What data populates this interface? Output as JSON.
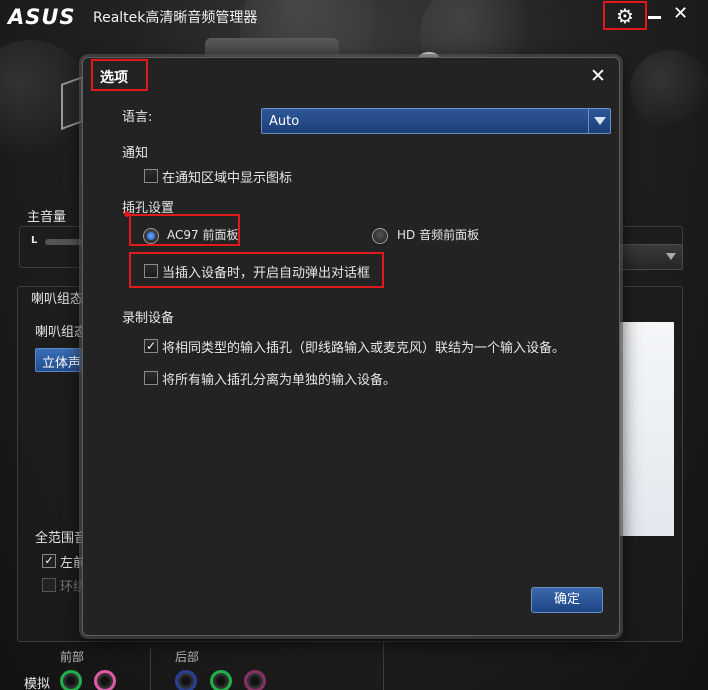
{
  "app": {
    "brand": "ASUS",
    "title": "Realtek高清晰音频管理器"
  },
  "background": {
    "main_volume_label": "主音量",
    "channel_label_L": "L",
    "speaker_config_tab": "喇叭组态",
    "speaker_config_label": "喇叭组态",
    "stereo_button": "立体声",
    "full_range_label": "全范围音",
    "front_lr_label": "左前",
    "surround_label": "环绕",
    "front_label": "前部",
    "rear_label": "后部",
    "analog_label": "模拟"
  },
  "dialog": {
    "title": "选项",
    "language": {
      "label": "语言:",
      "value": "Auto"
    },
    "notification": {
      "heading": "通知",
      "show_icon_label": "在通知区域中显示图标",
      "show_icon_checked": false
    },
    "jack_settings": {
      "heading": "插孔设置",
      "ac97_label": "AC97 前面板",
      "hd_label": "HD 音频前面板",
      "selected": "AC97 前面板",
      "popup_label": "当插入设备时，开启自动弹出对话框",
      "popup_checked": false
    },
    "recording": {
      "heading": "录制设备",
      "combine_label": "将相同类型的输入插孔（即线路输入或麦克风）联结为一个输入设备。",
      "combine_checked": true,
      "separate_label": "将所有输入插孔分离为单独的输入设备。",
      "separate_checked": false
    },
    "ok_label": "确定"
  },
  "colors": {
    "highlight_red": "#e0191c",
    "accent_blue": "#2e5797",
    "jack_green": "#1fb04a",
    "jack_pink": "#e05aa8",
    "jack_blue": "#2a3f9a",
    "jack_dark_pink": "#8a3066"
  },
  "icons": {
    "settings": "gear-icon",
    "minimize": "minimize-icon",
    "close": "close-icon"
  }
}
